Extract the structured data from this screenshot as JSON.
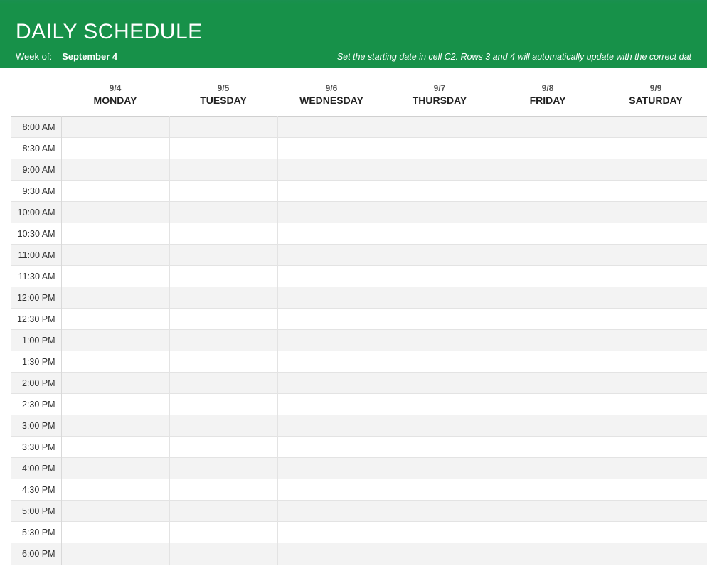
{
  "header": {
    "title": "DAILY SCHEDULE",
    "week_of_label": "Week of:",
    "week_of_value": "September 4",
    "instruction": "Set the starting date in cell C2. Rows 3 and 4 will automatically update with the correct dat"
  },
  "days": [
    {
      "date": "9/4",
      "name": "MONDAY"
    },
    {
      "date": "9/5",
      "name": "TUESDAY"
    },
    {
      "date": "9/6",
      "name": "WEDNESDAY"
    },
    {
      "date": "9/7",
      "name": "THURSDAY"
    },
    {
      "date": "9/8",
      "name": "FRIDAY"
    },
    {
      "date": "9/9",
      "name": "SATURDAY"
    }
  ],
  "times": [
    "8:00 AM",
    "8:30 AM",
    "9:00 AM",
    "9:30 AM",
    "10:00 AM",
    "10:30 AM",
    "11:00 AM",
    "11:30 AM",
    "12:00 PM",
    "12:30 PM",
    "1:00 PM",
    "1:30 PM",
    "2:00 PM",
    "2:30 PM",
    "3:00 PM",
    "3:30 PM",
    "4:00 PM",
    "4:30 PM",
    "5:00 PM",
    "5:30 PM",
    "6:00 PM"
  ]
}
